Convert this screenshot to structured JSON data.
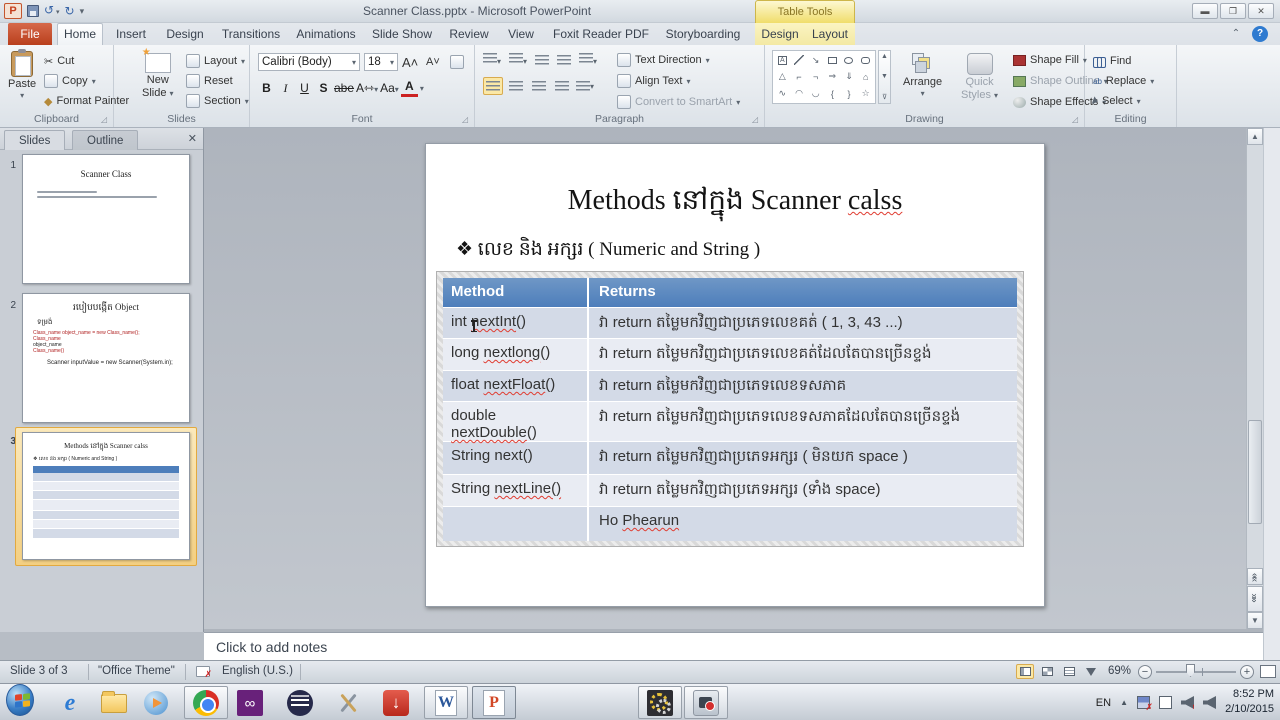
{
  "titlebar": {
    "title": "Scanner Class.pptx - Microsoft PowerPoint",
    "context_group": "Table Tools"
  },
  "tabs": {
    "file": "File",
    "home": "Home",
    "insert": "Insert",
    "design": "Design",
    "transitions": "Transitions",
    "animations": "Animations",
    "slideshow": "Slide Show",
    "review": "Review",
    "view": "View",
    "foxit": "Foxit Reader PDF",
    "storyboarding": "Storyboarding",
    "tt_design": "Design",
    "tt_layout": "Layout"
  },
  "ribbon": {
    "clipboard": {
      "label": "Clipboard",
      "paste": "Paste",
      "cut": "Cut",
      "copy": "Copy",
      "format_painter": "Format Painter"
    },
    "slides": {
      "label": "Slides",
      "new_slide_1": "New",
      "new_slide_2": "Slide",
      "layout": "Layout",
      "reset": "Reset",
      "section": "Section"
    },
    "font": {
      "label": "Font",
      "name": "Calibri (Body)",
      "size": "18"
    },
    "paragraph": {
      "label": "Paragraph",
      "text_direction": "Text Direction",
      "align_text": "Align Text",
      "convert": "Convert to SmartArt"
    },
    "drawing": {
      "label": "Drawing",
      "arrange": "Arrange",
      "quick_styles_1": "Quick",
      "quick_styles_2": "Styles",
      "shape_fill": "Shape Fill",
      "shape_outline": "Shape Outline",
      "shape_effects": "Shape Effects"
    },
    "editing": {
      "label": "Editing",
      "find": "Find",
      "replace": "Replace",
      "select": "Select"
    }
  },
  "panel": {
    "slides_tab": "Slides",
    "outline_tab": "Outline",
    "thumb1": {
      "number": "1",
      "title": "Scanner Class"
    },
    "thumb2": {
      "number": "2",
      "title": "របៀបបង្កើត Object",
      "subtitle": "ទម្រង់",
      "b1": "Class_name object_name = new Class_name();",
      "b2": "Class_name",
      "b3": "object_name",
      "b4": "Class_name()",
      "example": "Scanner inputValue = new Scanner(System.in);"
    },
    "thumb3": {
      "number": "3",
      "title": "Methods នៅក្នុង Scanner calss",
      "subtitle": "❖ លេខ និង អក្សរ ( Numeric and String )"
    }
  },
  "slide": {
    "title_pre": "Methods នៅក្នុង Scanner ",
    "title_wavy": "calss",
    "bullet": "❖ លេខ និង អក្សរ ( Numeric and String )",
    "table": {
      "h_method": "Method",
      "h_returns": "Returns",
      "rows": [
        {
          "m_pre": "int ",
          "m_wavy": "nextInt",
          "m_post": "()",
          "returns": "វា return តម្លៃមកវិញជាប្រភេទលេខគត់ ( 1, 3, 43 ...)"
        },
        {
          "m_pre": "long ",
          "m_wavy": "nextlong",
          "m_post": "()",
          "returns": "វា return តម្លៃមកវិញជាប្រភេទលេខគត់ដែលតែបានច្រើនខ្ទង់"
        },
        {
          "m_pre": "float ",
          "m_wavy": "nextFloat",
          "m_post": "()",
          "returns": "វា return តម្លៃមកវិញជាប្រភេទលេខទសភាគ"
        },
        {
          "m_pre": "double ",
          "m_wavy": "nextDouble",
          "m_post": "()",
          "returns": "វា return តម្លៃមកវិញជាប្រភេទលេខទសភាគដែលតែបានច្រើនខ្ទង់"
        },
        {
          "m_pre": "String next()",
          "m_wavy": "",
          "m_post": "",
          "returns": "វា return តម្លៃមកវិញជាប្រភេទអក្សរ ( មិនយក space )"
        },
        {
          "m_pre": "String ",
          "m_wavy": "nextLine()",
          "m_post": "",
          "returns": "វា return តម្លៃមកវិញជាប្រភេទអក្សរ (ទាំង space)"
        },
        {
          "m_pre": "",
          "m_wavy": "",
          "m_post": "",
          "returns_pre": "Ho ",
          "returns_wavy": "Phearun"
        }
      ]
    }
  },
  "notes": {
    "placeholder": "Click to add notes"
  },
  "status": {
    "slide": "Slide 3 of 3",
    "theme": "\"Office Theme\"",
    "language": "English (U.S.)",
    "zoom": "69%"
  },
  "taskbar": {
    "lang": "EN",
    "time": "8:52 PM",
    "date": "2/10/2015"
  }
}
